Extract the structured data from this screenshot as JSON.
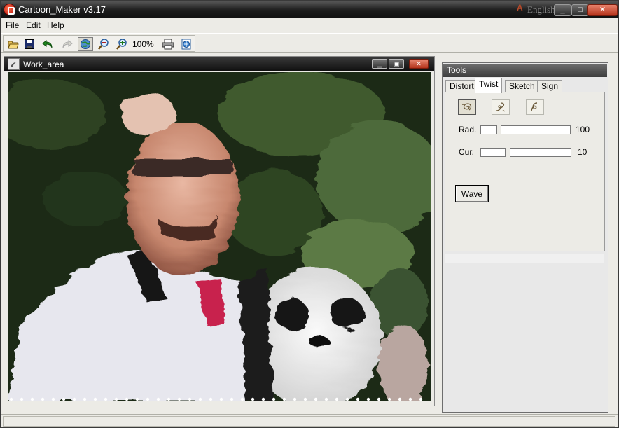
{
  "window": {
    "title": "Cartoon_Maker v3.17",
    "language": "English",
    "buttons": {
      "minimize": "_",
      "maximize": "□",
      "close": "✕"
    }
  },
  "menu": [
    {
      "label": "File",
      "accel": "F",
      "rest": "ile"
    },
    {
      "label": "Edit",
      "accel": "E",
      "rest": "dit"
    },
    {
      "label": "Help",
      "accel": "H",
      "rest": "elp"
    }
  ],
  "toolbar": {
    "zoom": "100%"
  },
  "work_area": {
    "title": "Work_area"
  },
  "tools": {
    "title": "Tools",
    "tabs": [
      "Distort",
      "Twist",
      "Sketch",
      "Sign"
    ],
    "active_tab": "Twist",
    "rad": {
      "label": "Rad.",
      "value": "100"
    },
    "cur": {
      "label": "Cur.",
      "value": "10"
    },
    "wave_button": "Wave"
  },
  "colors": {
    "title_bar": "#1c1c1c",
    "window_bg": "#ecebe6",
    "close_red": "#c0391f"
  }
}
